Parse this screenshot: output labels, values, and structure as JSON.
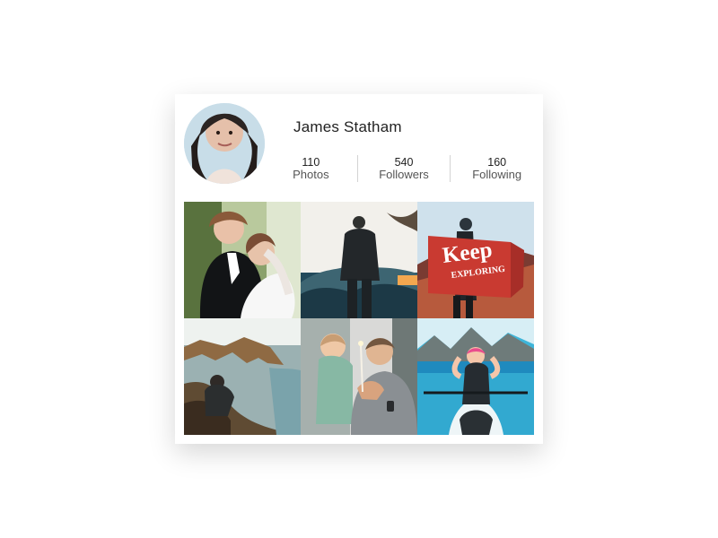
{
  "profile": {
    "name": "James Statham",
    "avatar_alt": "profile-avatar"
  },
  "stats": [
    {
      "value": "110",
      "label": "Photos"
    },
    {
      "value": "540",
      "label": "Followers"
    },
    {
      "value": "160",
      "label": "Following"
    }
  ],
  "grid": {
    "photos": [
      {
        "subject": "wedding couple"
      },
      {
        "subject": "man looking at mountains"
      },
      {
        "subject": "keep exploring flag"
      },
      {
        "subject": "coastal cliffs"
      },
      {
        "subject": "father and child"
      },
      {
        "subject": "kayak on lake"
      }
    ],
    "flag_text_1": "Keep",
    "flag_text_2": "EXPLORING"
  },
  "colors": {
    "card_bg": "#ffffff",
    "divider": "#d3d3d3",
    "flag_red": "#c93a31"
  }
}
